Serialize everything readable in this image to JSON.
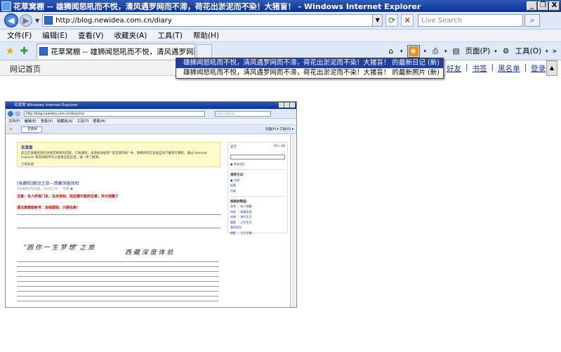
{
  "window": {
    "title": "花草窝棚 -- 雄狮闻怒吼而不悦，清风遇罗网而不滞，荷花出淤泥而不染！大猪盲！ - Windows Internet Explorer",
    "minimize": "_",
    "maximize": "❐",
    "close": "X"
  },
  "address": {
    "url": "http://blog.newidea.com.cn/diary",
    "search_placeholder": "Live Search"
  },
  "menu": [
    "文件(F)",
    "编辑(E)",
    "查看(V)",
    "收藏夹(A)",
    "工具(T)",
    "帮助(H)"
  ],
  "tab": {
    "label": "花草窝棚 -- 雄狮闻怒吼而不悦，清风遇罗网而不..."
  },
  "commandbar": {
    "page_label": "页面(P)",
    "tools_label": "工具(O)",
    "more": "»"
  },
  "feeds": [
    "雄狮闻怒吼而不悦，清风遇罗网而不滞，荷花出淤泥而不染！大猪盲！ 的最新日记 (新)",
    "雄狮闻怒吼而不悦，清风遇罗网而不滞，荷花出淤泥而不染！大猪盲！ 的最新照片 (新)"
  ],
  "site": {
    "home": "网记首页",
    "links": [
      "好友",
      "书签",
      "黑名单",
      "登录"
    ]
  },
  "mini": {
    "title": "花草窝    Windows Internet Explorer",
    "url": "http://blog.newidea.com.cn/diary/me",
    "search": "Live Search",
    "menu": [
      "文件(F)",
      "编辑(E)",
      "查看(V)",
      "收藏夹(A)",
      "工具(T)",
      "帮助(H)"
    ],
    "tab": "花草窝",
    "tools": "页面(P) ▾  工具(O) ▾",
    "info_title": "花草窝",
    "info_text": "您正在查看的源包含经常更新的内容。订阅源后，该源会添加到 \"常见源列表\" 中。源更新的信息会自动下载到计算机，通过 Internet Explorer 和其他程序可以查看这些信息。进一步了解源。",
    "info_link": "订阅该源",
    "post_title": "[收藏帖]撤动之旅—西藏深度体验",
    "post_meta": "2008年4月28日，10:05:28 ｜ 作者 ●",
    "red1": "注意：本人所有门本，在未告知，前后需不能的文章，并计划赠了",
    "red2": "请注意微软帐号：忽视跟踪，只要在家！",
    "heading": "\"圆 你 一 生 梦 想\" 之 旅",
    "sub": "西 藏 深 度 体 验",
    "side_title": "显示",
    "side_count": "40 / 40",
    "side_all": "● 所有项目",
    "side_sort_head": "排序方式：",
    "side_sort": [
      "● 日期",
      "标题",
      "作者"
    ],
    "side_filter_head": "按类别筛选：",
    "side_filter": [
      "游戏 ｜ 私人物藏",
      "科技 ｜ 随便说说",
      "经典 ｜ 旅行生活",
      "睡眠 ｜ 工作生活",
      "我的室所",
      "摄影 ｜ 日子文摘"
    ]
  }
}
